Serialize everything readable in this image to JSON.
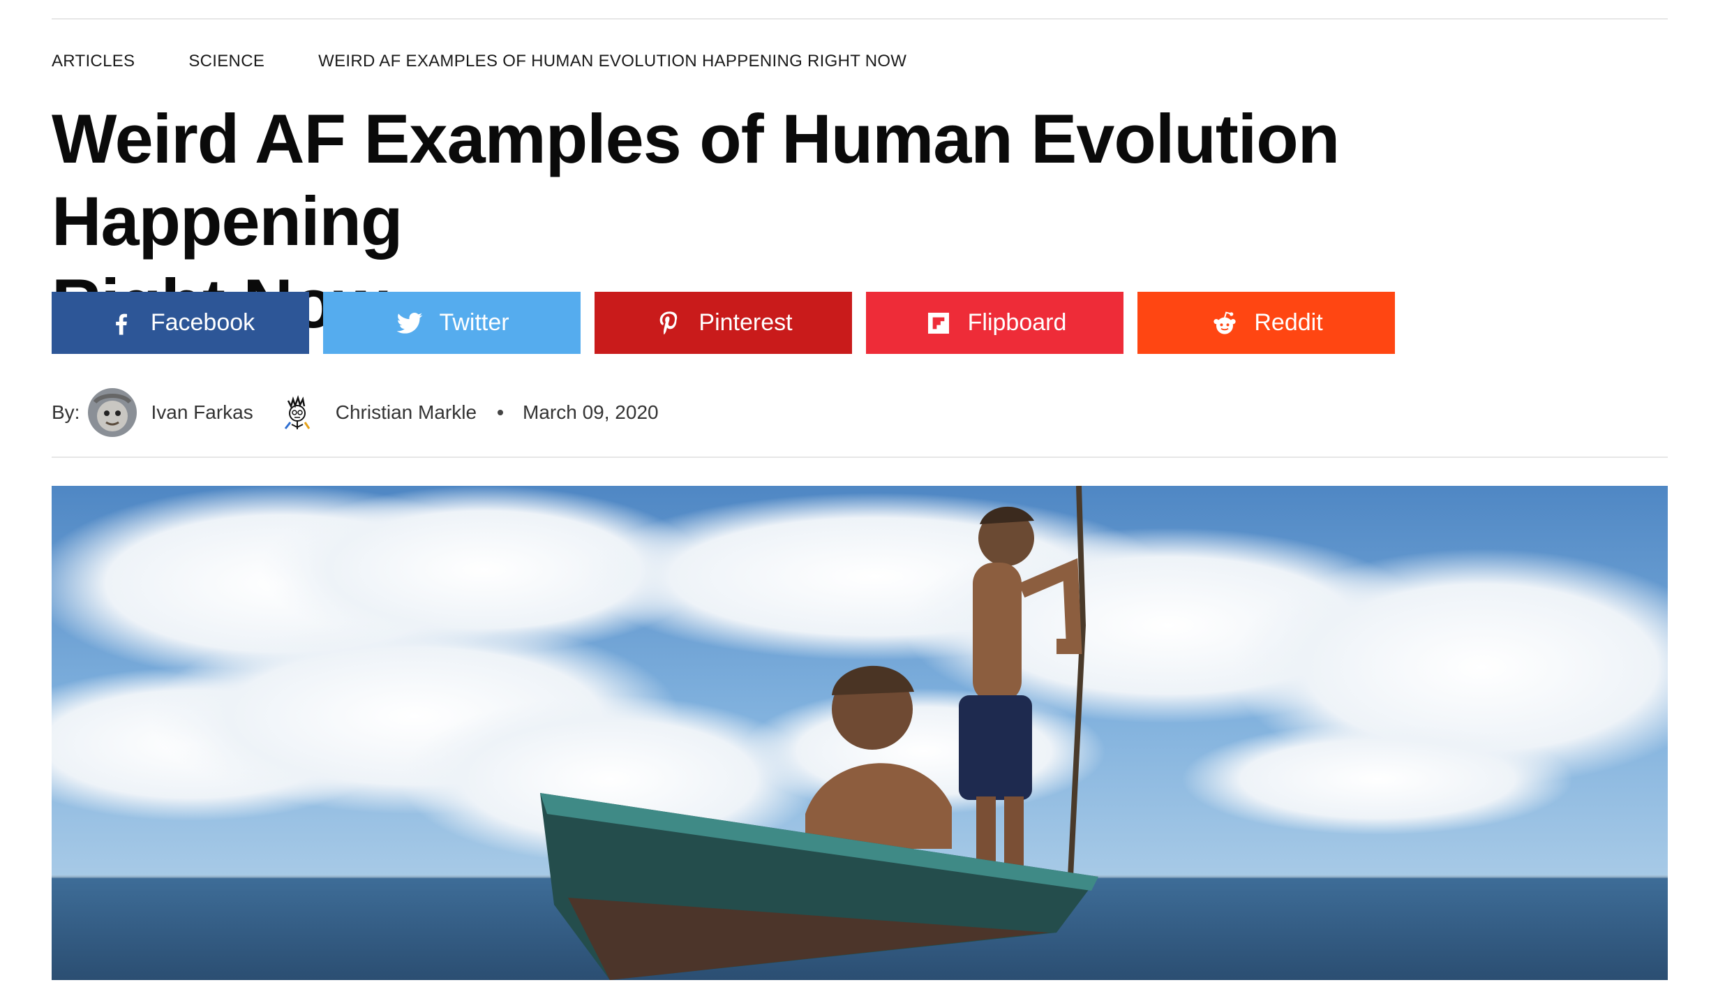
{
  "breadcrumbs": [
    "ARTICLES",
    "SCIENCE",
    "WEIRD AF EXAMPLES OF HUMAN EVOLUTION HAPPENING RIGHT NOW"
  ],
  "title_line1": "Weird AF Examples of Human Evolution Happening",
  "title_line2": "Right Now",
  "share_buttons": [
    {
      "label": "Facebook",
      "icon": "facebook-icon",
      "color": "#2d5697"
    },
    {
      "label": "Twitter",
      "icon": "twitter-icon",
      "color": "#55acee"
    },
    {
      "label": "Pinterest",
      "icon": "pinterest-icon",
      "color": "#c91b1b"
    },
    {
      "label": "Flipboard",
      "icon": "flipboard-icon",
      "color": "#ee2c38"
    },
    {
      "label": "Reddit",
      "icon": "reddit-icon",
      "color": "#ff4612"
    }
  ],
  "byline": {
    "prefix": "By:",
    "authors": [
      "Ivan Farkas",
      "Christian Markle"
    ],
    "date": "March 09, 2020"
  },
  "hero_image": {
    "subject": "two boys in a wooden canoe on the sea under a cloudy blue sky"
  }
}
